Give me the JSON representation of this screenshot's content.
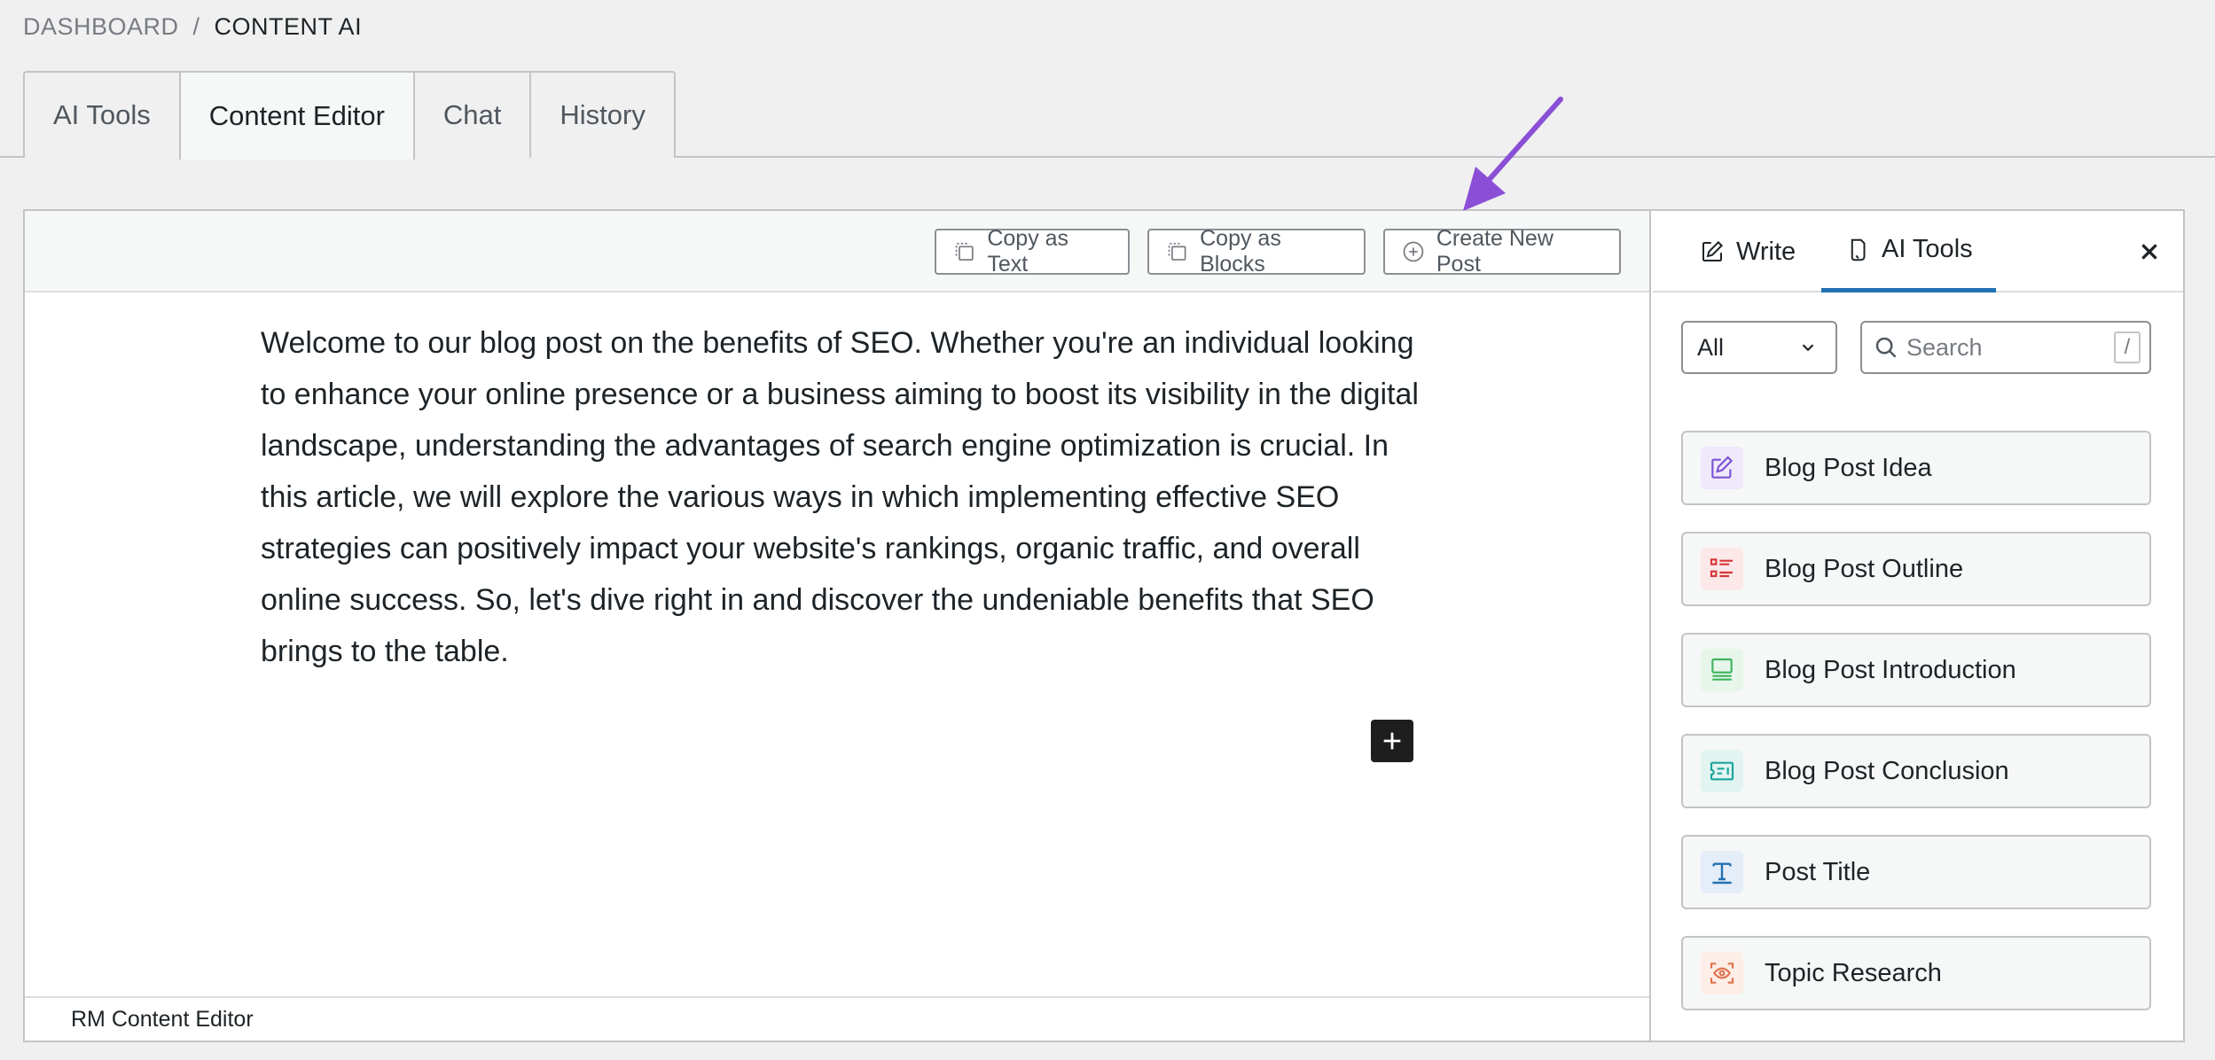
{
  "breadcrumb": {
    "parent": "DASHBOARD",
    "separator": "/",
    "current": "CONTENT AI"
  },
  "top_tabs": [
    {
      "label": "AI Tools"
    },
    {
      "label": "Content Editor",
      "active": true
    },
    {
      "label": "Chat"
    },
    {
      "label": "History"
    }
  ],
  "toolbar": {
    "copy_text": "Copy as Text",
    "copy_blocks": "Copy as Blocks",
    "create_post": "Create New Post"
  },
  "editor": {
    "content": "Welcome to our blog post on the benefits of SEO. Whether you're an individual looking to enhance your online presence or a business aiming to boost its visibility in the digital landscape, understanding the advantages of search engine optimization is crucial. In this article, we will explore the various ways in which implementing effective SEO strategies can positively impact your website's rankings, organic traffic, and overall online success. So, let's dive right in and discover the undeniable benefits that SEO brings to the table.",
    "footer": "RM Content Editor"
  },
  "sidebar": {
    "tabs": [
      {
        "label": "Write",
        "icon": "edit-icon"
      },
      {
        "label": "AI Tools",
        "icon": "ai-tools-icon",
        "active": true
      }
    ],
    "filter": {
      "selected": "All"
    },
    "search": {
      "placeholder": "Search",
      "shortcut": "/"
    },
    "tools": [
      {
        "label": "Blog Post Idea",
        "icon": "idea-edit-icon",
        "color": "#7b51d3",
        "bg": "#efe9fb"
      },
      {
        "label": "Blog Post Outline",
        "icon": "list-icon",
        "color": "#d63638",
        "bg": "#fce8e8"
      },
      {
        "label": "Blog Post Introduction",
        "icon": "intro-icon",
        "color": "#3eb35d",
        "bg": "#e6f6ea"
      },
      {
        "label": "Blog Post Conclusion",
        "icon": "conclusion-icon",
        "color": "#1aa59a",
        "bg": "#e1f4f2"
      },
      {
        "label": "Post Title",
        "icon": "title-icon",
        "color": "#2271b1",
        "bg": "#e5edf8"
      },
      {
        "label": "Topic Research",
        "icon": "research-icon",
        "color": "#e0734d",
        "bg": "#fdeee7"
      }
    ]
  },
  "colors": {
    "accent": "#2271b1",
    "annotation_arrow": "#8a4fd6",
    "add_block_bg": "#1e1e1e"
  }
}
